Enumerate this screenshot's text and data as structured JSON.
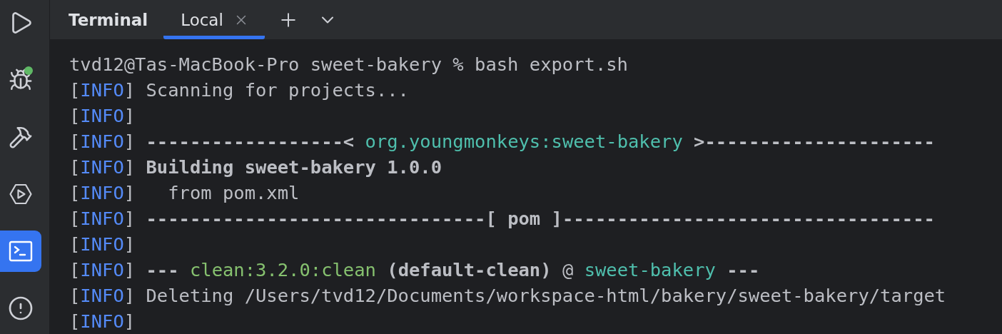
{
  "sidebar": {
    "items": [
      {
        "kind": "run",
        "selected": false,
        "notification": false
      },
      {
        "kind": "debug",
        "selected": false,
        "notification": true
      },
      {
        "kind": "build",
        "selected": false,
        "notification": false
      },
      {
        "kind": "services",
        "selected": false,
        "notification": false
      },
      {
        "kind": "terminal",
        "selected": true,
        "notification": false
      },
      {
        "kind": "problems",
        "selected": false,
        "notification": false
      }
    ]
  },
  "panel": {
    "title": "Terminal",
    "tabs": [
      {
        "label": "Local",
        "selected": true,
        "closable": true
      }
    ]
  },
  "terminal": {
    "lines": [
      [
        {
          "kind": "plain",
          "text": "tvd12@Tas-MacBook-Pro sweet-bakery % bash export.sh"
        }
      ],
      [
        {
          "kind": "plain",
          "text": "["
        },
        {
          "kind": "tag",
          "text": "INFO"
        },
        {
          "kind": "plain",
          "text": "] Scanning for projects..."
        }
      ],
      [
        {
          "kind": "plain",
          "text": "["
        },
        {
          "kind": "tag",
          "text": "INFO"
        },
        {
          "kind": "plain",
          "text": "]"
        }
      ],
      [
        {
          "kind": "plain",
          "text": "["
        },
        {
          "kind": "tag",
          "text": "INFO"
        },
        {
          "kind": "plain",
          "text": "] "
        },
        {
          "kind": "bold",
          "text": "------------------< "
        },
        {
          "kind": "cyan",
          "text": "org.youngmonkeys:sweet-bakery"
        },
        {
          "kind": "bold",
          "text": " >---------------------"
        }
      ],
      [
        {
          "kind": "plain",
          "text": "["
        },
        {
          "kind": "tag",
          "text": "INFO"
        },
        {
          "kind": "plain",
          "text": "] "
        },
        {
          "kind": "bold",
          "text": "Building sweet-bakery 1.0.0"
        }
      ],
      [
        {
          "kind": "plain",
          "text": "["
        },
        {
          "kind": "tag",
          "text": "INFO"
        },
        {
          "kind": "plain",
          "text": "]   from pom.xml"
        }
      ],
      [
        {
          "kind": "plain",
          "text": "["
        },
        {
          "kind": "tag",
          "text": "INFO"
        },
        {
          "kind": "plain",
          "text": "] "
        },
        {
          "kind": "bold",
          "text": "-------------------------------[ pom ]----------------------------------"
        }
      ],
      [
        {
          "kind": "plain",
          "text": "["
        },
        {
          "kind": "tag",
          "text": "INFO"
        },
        {
          "kind": "plain",
          "text": "]"
        }
      ],
      [
        {
          "kind": "plain",
          "text": "["
        },
        {
          "kind": "tag",
          "text": "INFO"
        },
        {
          "kind": "plain",
          "text": "] "
        },
        {
          "kind": "bold",
          "text": "--- "
        },
        {
          "kind": "green",
          "text": "clean:3.2.0:clean"
        },
        {
          "kind": "bold",
          "text": " (default-clean)"
        },
        {
          "kind": "plain",
          "text": " @ "
        },
        {
          "kind": "cyan",
          "text": "sweet-bakery"
        },
        {
          "kind": "bold",
          "text": " ---"
        }
      ],
      [
        {
          "kind": "plain",
          "text": "["
        },
        {
          "kind": "tag",
          "text": "INFO"
        },
        {
          "kind": "plain",
          "text": "] Deleting /Users/tvd12/Documents/workspace-html/bakery/sweet-bakery/target"
        }
      ],
      [
        {
          "kind": "plain",
          "text": "["
        },
        {
          "kind": "tag",
          "text": "INFO"
        },
        {
          "kind": "plain",
          "text": "]"
        }
      ]
    ]
  }
}
